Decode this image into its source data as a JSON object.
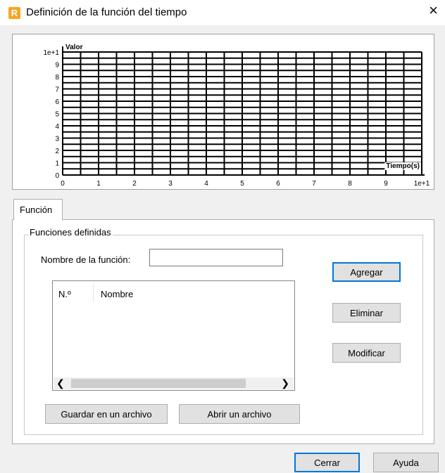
{
  "window": {
    "title": "Definición de la función del tiempo",
    "app_icon_letter": "R",
    "close_symbol": "×"
  },
  "chart_data": {
    "type": "line",
    "ylabel": "Valor",
    "xlabel": "Tiempo(s)",
    "x_ticks": [
      "0",
      "1",
      "2",
      "3",
      "4",
      "5",
      "6",
      "7",
      "8",
      "9",
      "1e+1"
    ],
    "y_ticks": [
      "0",
      "1",
      "2",
      "3",
      "4",
      "5",
      "6",
      "7",
      "8",
      "9",
      "1e+1"
    ],
    "xlim": [
      0,
      10
    ],
    "ylim": [
      0,
      10
    ],
    "grid": true,
    "minor_divisions": 2,
    "series": []
  },
  "tabs": [
    {
      "label": "Función"
    }
  ],
  "group": {
    "title": "Funciones definidas",
    "name_label": "Nombre de la función:",
    "name_value": ""
  },
  "list": {
    "columns": [
      "N.º",
      "Nombre"
    ],
    "rows": []
  },
  "buttons": {
    "add": "Agregar",
    "delete": "Eliminar",
    "modify": "Modificar",
    "save_file": "Guardar en un archivo",
    "open_file": "Abrir un archivo",
    "close": "Cerrar",
    "help": "Ayuda"
  },
  "icons": {
    "app": "revit-r-icon",
    "close": "close-icon",
    "scroll_left": "chevron-left-icon",
    "scroll_right": "chevron-right-icon"
  },
  "colors": {
    "accent": "#0078d7",
    "app_icon": "#f5a623"
  }
}
